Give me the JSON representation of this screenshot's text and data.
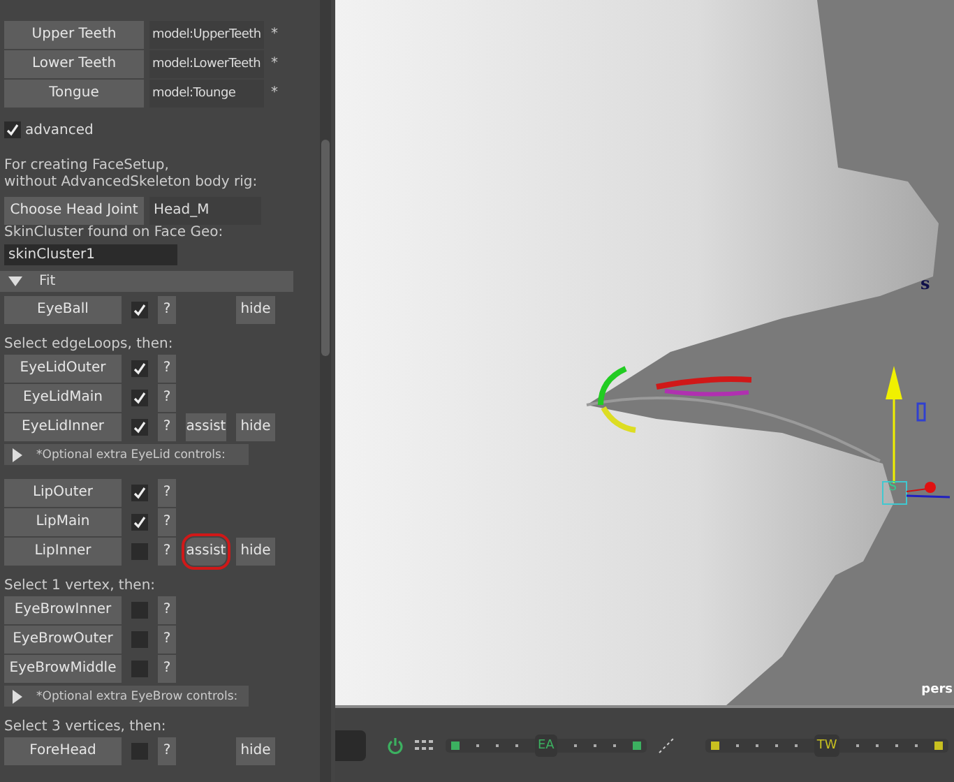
{
  "panel": {
    "geo_rows": [
      {
        "button": "Upper Teeth",
        "value": "model:UpperTeeth",
        "mark": "*"
      },
      {
        "button": "Lower Teeth",
        "value": "model:LowerTeeth",
        "mark": "*"
      },
      {
        "button": "Tongue",
        "value": "model:Tounge",
        "mark": "*"
      }
    ],
    "advanced": {
      "label": "advanced",
      "checked": true
    },
    "note": [
      "For creating FaceSetup,",
      "without AdvancedSkeleton body rig:"
    ],
    "head_joint": {
      "button": "Choose Head Joint",
      "value": "Head_M"
    },
    "skin_label": "SkinCluster found on Face Geo:",
    "skin_value": "skinCluster1",
    "fit": {
      "title": "Fit",
      "expanded": true
    },
    "items": [
      {
        "kind": "control",
        "label": "EyeBall",
        "checked": true,
        "help": "?",
        "hide": "hide"
      },
      {
        "kind": "label",
        "text": "Select edgeLoops, then:"
      },
      {
        "kind": "control",
        "label": "EyeLidOuter",
        "checked": true,
        "help": "?"
      },
      {
        "kind": "control",
        "label": "EyeLidMain",
        "checked": true,
        "help": "?"
      },
      {
        "kind": "control",
        "label": "EyeLidInner",
        "checked": true,
        "help": "?",
        "assist": "assist",
        "hide": "hide"
      },
      {
        "kind": "section",
        "text": "*Optional extra EyeLid controls:",
        "expanded": false
      },
      {
        "kind": "control",
        "label": "LipOuter",
        "checked": true,
        "help": "?"
      },
      {
        "kind": "control",
        "label": "LipMain",
        "checked": true,
        "help": "?"
      },
      {
        "kind": "control",
        "label": "LipInner",
        "checked": false,
        "help": "?",
        "assist": "assist",
        "hide": "hide",
        "circled": true
      },
      {
        "kind": "label",
        "text": "Select 1 vertex, then:"
      },
      {
        "kind": "control",
        "label": "EyeBrowInner",
        "checked": false,
        "help": "?"
      },
      {
        "kind": "control",
        "label": "EyeBrowOuter",
        "checked": false,
        "help": "?"
      },
      {
        "kind": "control",
        "label": "EyeBrowMiddle",
        "checked": false,
        "help": "?"
      },
      {
        "kind": "section",
        "text": "*Optional extra EyeBrow controls:",
        "expanded": false
      },
      {
        "kind": "label",
        "text": "Select 3 vertices, then:"
      },
      {
        "kind": "control",
        "label": "ForeHead",
        "checked": false,
        "help": "?",
        "hide": "hide"
      }
    ]
  },
  "viewport": {
    "camera": "pers",
    "gizmo_labels": [
      "s",
      "S"
    ]
  },
  "time_bar": {
    "markers": [
      "EA",
      "TW"
    ]
  }
}
